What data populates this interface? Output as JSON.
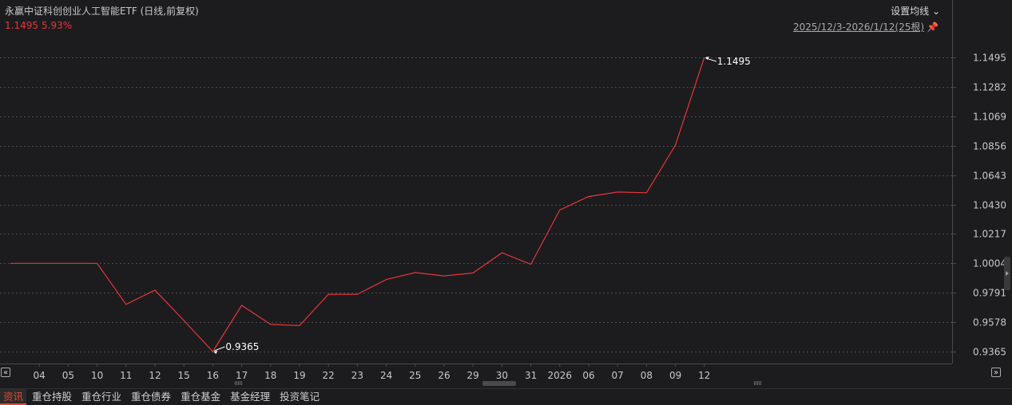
{
  "header": {
    "title": "永赢中证科创创业人工智能ETF (日线,前复权)",
    "last_price": "1.1495",
    "change_pct": "5.93%",
    "ma_setting_label": "设置均线",
    "range_label": "2025/12/3-2026/1/12(25根)"
  },
  "colors": {
    "background": "#1c1c1e",
    "line": "#e8343a",
    "grid": "#4a4a4a",
    "axis_text": "#c8c8c8",
    "annotation": "#ffffff",
    "active_tab": "#e64a2c"
  },
  "icons": {
    "ma_dropdown": "chevron-down-icon",
    "range_pin": "pin-icon",
    "nav_left": "double-chevron-left-icon",
    "nav_right": "double-chevron-right-icon"
  },
  "chart_data": {
    "type": "line",
    "x": [
      "2025-12-03",
      "2025-12-04",
      "2025-12-05",
      "2025-12-10",
      "2025-12-11",
      "2025-12-12",
      "2025-12-15",
      "2025-12-16",
      "2025-12-17",
      "2025-12-18",
      "2025-12-19",
      "2025-12-22",
      "2025-12-23",
      "2025-12-24",
      "2025-12-25",
      "2025-12-26",
      "2025-12-29",
      "2025-12-30",
      "2025-12-31",
      "2026-01-05",
      "2026-01-06",
      "2026-01-07",
      "2026-01-08",
      "2026-01-09",
      "2026-01-12"
    ],
    "x_tick_labels": [
      "04",
      "05",
      "10",
      "11",
      "12",
      "15",
      "16",
      "17",
      "18",
      "19",
      "22",
      "23",
      "24",
      "25",
      "26",
      "29",
      "30",
      "31",
      "2026",
      "06",
      "07",
      "08",
      "09",
      "12"
    ],
    "series": [
      {
        "values": [
          1.0004,
          1.0004,
          1.0004,
          1.0004,
          0.9707,
          0.981,
          0.959,
          0.9365,
          0.97,
          0.9562,
          0.9553,
          0.978,
          0.978,
          0.9887,
          0.9937,
          0.9913,
          0.9934,
          1.008,
          0.9997,
          1.039,
          1.0488,
          1.052,
          1.0515,
          1.086,
          1.1495
        ]
      }
    ],
    "y_ticks": [
      "1.1495",
      "1.1282",
      "1.1069",
      "1.0856",
      "1.0643",
      "1.0430",
      "1.0217",
      "1.0004",
      "0.9791",
      "0.9578",
      "0.9365"
    ],
    "ylim": [
      0.9365,
      1.1495
    ],
    "annotations": [
      {
        "label": "1.1495",
        "kind": "max"
      },
      {
        "label": "0.9365",
        "kind": "min"
      }
    ],
    "grid": true
  },
  "tabs": [
    {
      "label": "资讯",
      "active": true
    },
    {
      "label": "重仓持股",
      "active": false
    },
    {
      "label": "重仓行业",
      "active": false
    },
    {
      "label": "重仓债券",
      "active": false
    },
    {
      "label": "重仓基金",
      "active": false
    },
    {
      "label": "基金经理",
      "active": false
    },
    {
      "label": "投资笔记",
      "active": false
    }
  ]
}
